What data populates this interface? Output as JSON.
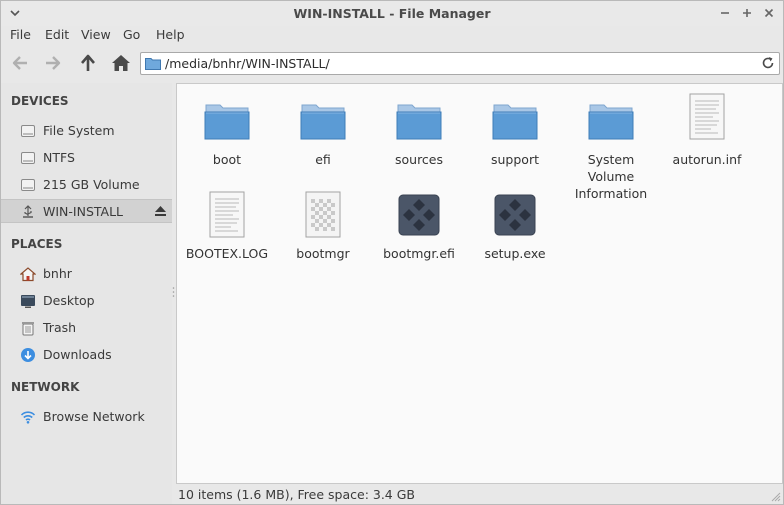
{
  "window": {
    "title": "WIN-INSTALL - File Manager"
  },
  "menu": [
    "File",
    "Edit",
    "View",
    "Go",
    "Help"
  ],
  "toolbar": {
    "icons": [
      "back-arrow-icon",
      "forward-arrow-icon",
      "up-arrow-icon",
      "home-icon"
    ],
    "location": "/media/bnhr/WIN-INSTALL/"
  },
  "sidebar": {
    "devices_heading": "DEVICES",
    "devices": [
      {
        "label": "File System",
        "icon": "drive-icon"
      },
      {
        "label": "NTFS",
        "icon": "drive-icon"
      },
      {
        "label": "215 GB Volume",
        "icon": "drive-icon"
      },
      {
        "label": "WIN-INSTALL",
        "icon": "usb-drive-icon",
        "selected": true
      }
    ],
    "places_heading": "PLACES",
    "places": [
      {
        "label": "bnhr",
        "icon": "home-icon"
      },
      {
        "label": "Desktop",
        "icon": "desktop-icon"
      },
      {
        "label": "Trash",
        "icon": "trash-icon"
      },
      {
        "label": "Downloads",
        "icon": "downloads-icon"
      }
    ],
    "network_heading": "NETWORK",
    "network": [
      {
        "label": "Browse Network",
        "icon": "wifi-icon"
      }
    ]
  },
  "files": [
    {
      "name": "boot",
      "type": "folder"
    },
    {
      "name": "efi",
      "type": "folder"
    },
    {
      "name": "sources",
      "type": "folder"
    },
    {
      "name": "support",
      "type": "folder"
    },
    {
      "name": "System Volume Information",
      "type": "folder"
    },
    {
      "name": "autorun.inf",
      "type": "text"
    },
    {
      "name": "BOOTEX.LOG",
      "type": "text"
    },
    {
      "name": "bootmgr",
      "type": "binary"
    },
    {
      "name": "bootmgr.efi",
      "type": "executable"
    },
    {
      "name": "setup.exe",
      "type": "executable"
    }
  ],
  "status": "10 items (1.6 MB), Free space: 3.4 GB",
  "colors": {
    "folder": "#5b9bd5",
    "selection": "#d2d2d2",
    "accent": "#3d8ee0"
  }
}
